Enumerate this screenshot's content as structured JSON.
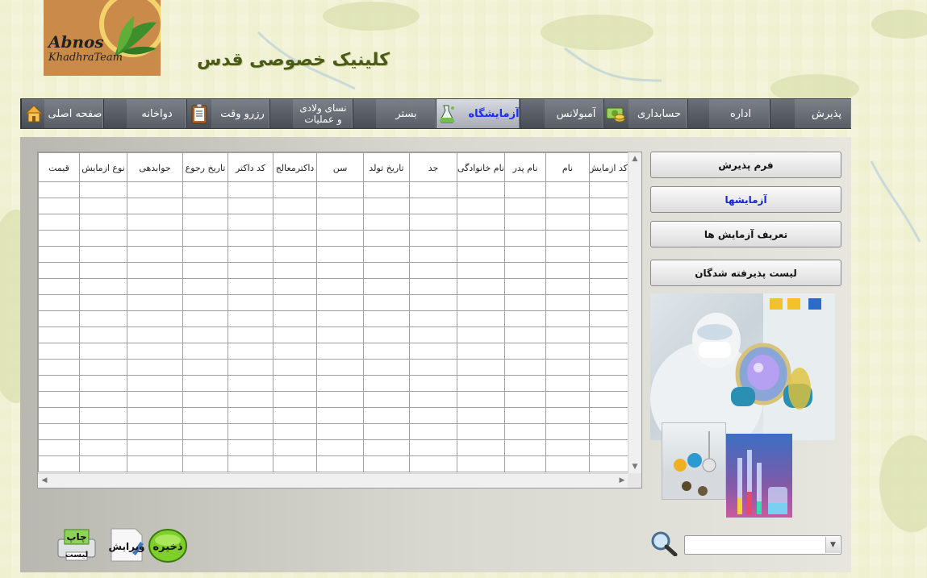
{
  "header": {
    "logo_line1": "Abnos",
    "logo_line2": "KhadhraTeam",
    "clinic_title": "کلینیک خصوصی قدس"
  },
  "nav": {
    "reception": "پذیرش",
    "admin": "اداره",
    "accounting": "حسابداری",
    "ambulance": "آمبولانس",
    "laboratory": "آزمایشگاه",
    "bed": "بستر",
    "obgyn_line1": "نسای ولادی",
    "obgyn_line2": "و عملیات",
    "appointment": "رزرو وقت",
    "pharmacy": "دواخانه",
    "home": "صفحه اصلی"
  },
  "side_menu": {
    "reception_form": "فرم پذیرش",
    "tests": "آزمایشها",
    "test_definitions": "تعریف آزمایش ها",
    "admitted_list": "لیست پذیرفته شدگان"
  },
  "grid": {
    "columns": [
      "کد ازمایش",
      "نام",
      "نام پدر",
      "نام خانوادگی",
      "جد",
      "تاریخ تولد",
      "سن",
      "داکترمعالج",
      "کد داکتر",
      "تاریخ رجوع",
      "جوابدهی",
      "نوع ازمایش",
      "قیمت"
    ],
    "row_count": 18
  },
  "actions": {
    "save": "ذخیره",
    "edit": "ویرایش",
    "print_line1": "چاپ",
    "print_line2": "لیست"
  },
  "search": {
    "value": ""
  },
  "colors": {
    "nav_bg": "#585d66",
    "active_tab_text": "#1a2cf0",
    "title": "#4b5a18"
  }
}
